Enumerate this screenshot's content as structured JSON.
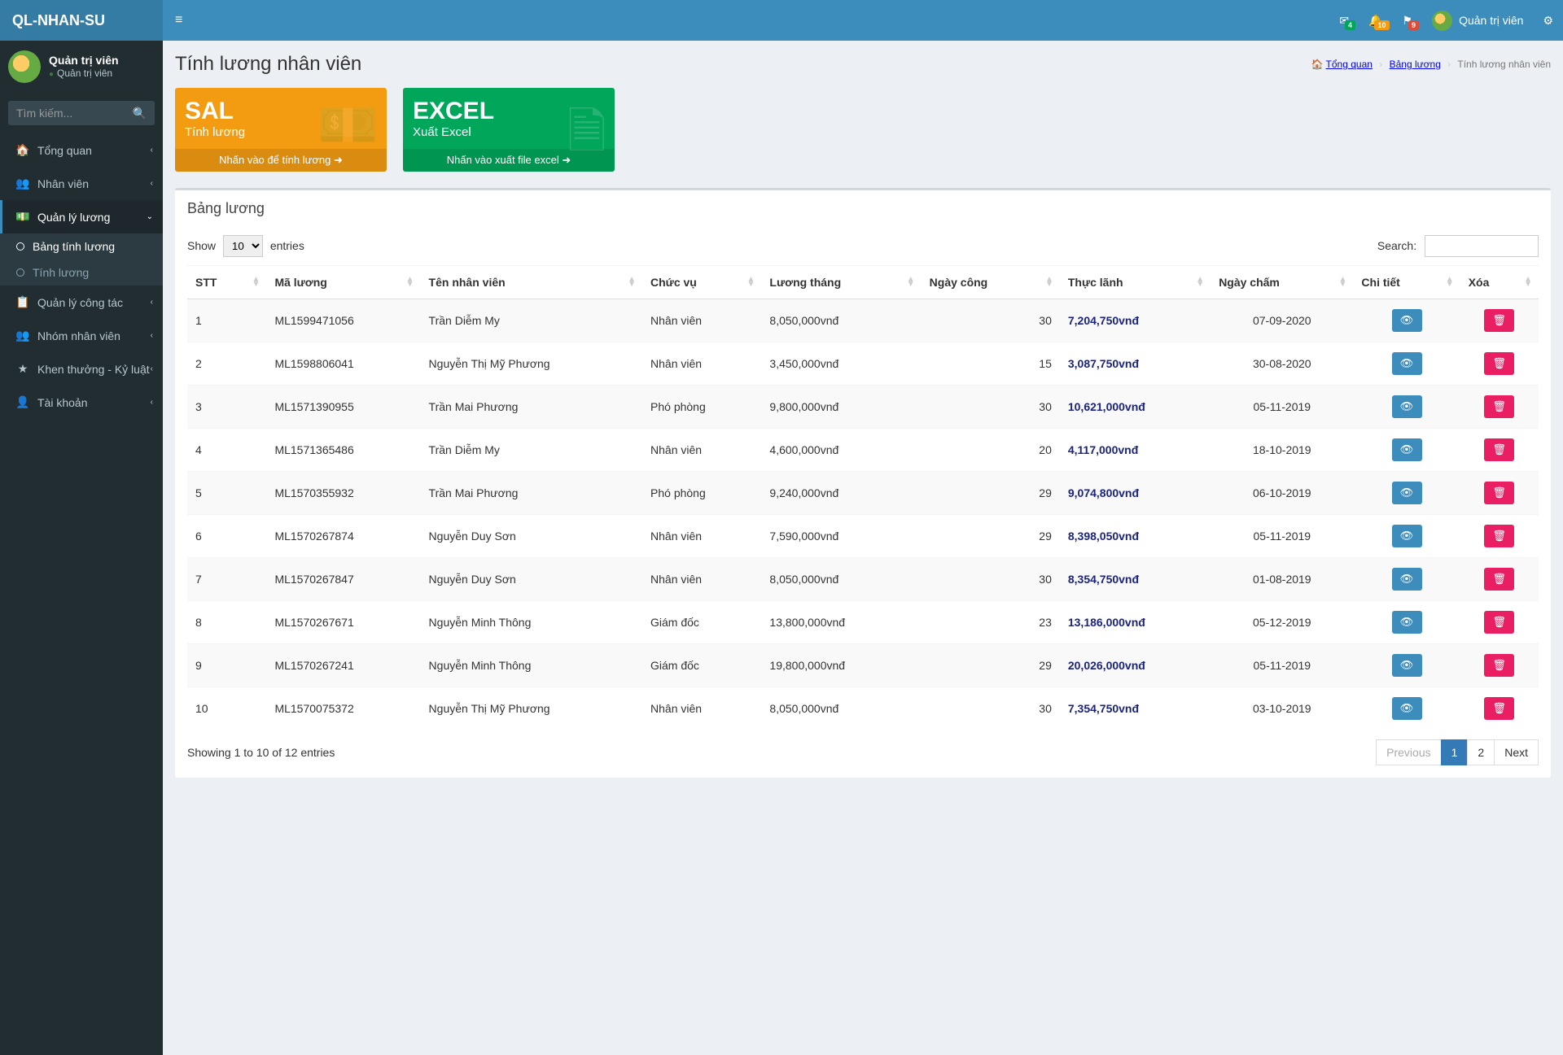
{
  "brand": "QL-NHAN-SU",
  "user": {
    "name": "Quản trị viên",
    "role": "Quản trị viên"
  },
  "search": {
    "placeholder": "Tìm kiếm..."
  },
  "nav": {
    "items": [
      {
        "label": "Tổng quan"
      },
      {
        "label": "Nhân viên"
      },
      {
        "label": "Quản lý lương",
        "sub": [
          {
            "label": "Bảng tính lương",
            "active": true
          },
          {
            "label": "Tính lương"
          }
        ]
      },
      {
        "label": "Quản lý công tác"
      },
      {
        "label": "Nhóm nhân viên"
      },
      {
        "label": "Khen thưởng - Kỷ luật"
      },
      {
        "label": "Tài khoản"
      }
    ]
  },
  "topbar": {
    "badges": {
      "mail": "4",
      "bell": "10",
      "flag": "9"
    },
    "username": "Quản trị viên"
  },
  "page": {
    "title": "Tính lương nhân viên",
    "breadcrumb": {
      "home": "Tổng quan",
      "mid": "Bảng lương",
      "last": "Tính lương nhân viên"
    }
  },
  "cards": {
    "sal": {
      "title": "SAL",
      "subtitle": "Tính lương",
      "footer": "Nhấn vào để tính lương"
    },
    "excel": {
      "title": "EXCEL",
      "subtitle": "Xuất Excel",
      "footer": "Nhấn vào xuất file excel"
    }
  },
  "box": {
    "title": "Bảng lương"
  },
  "datatable": {
    "show_label": "Show",
    "entries_label": "entries",
    "length_value": "10",
    "search_label": "Search:",
    "columns": [
      "STT",
      "Mã lương",
      "Tên nhân viên",
      "Chức vụ",
      "Lương tháng",
      "Ngày công",
      "Thực lãnh",
      "Ngày chấm",
      "Chi tiết",
      "Xóa"
    ],
    "rows": [
      {
        "stt": "1",
        "ma": "ML1599471056",
        "ten": "Trần Diễm My",
        "cv": "Nhân viên",
        "luong": "8,050,000vnđ",
        "cong": "30",
        "thuc": "7,204,750vnđ",
        "ngay": "07-09-2020"
      },
      {
        "stt": "2",
        "ma": "ML1598806041",
        "ten": "Nguyễn Thị Mỹ Phương",
        "cv": "Nhân viên",
        "luong": "3,450,000vnđ",
        "cong": "15",
        "thuc": "3,087,750vnđ",
        "ngay": "30-08-2020"
      },
      {
        "stt": "3",
        "ma": "ML1571390955",
        "ten": "Trần Mai Phương",
        "cv": "Phó phòng",
        "luong": "9,800,000vnđ",
        "cong": "30",
        "thuc": "10,621,000vnđ",
        "ngay": "05-11-2019"
      },
      {
        "stt": "4",
        "ma": "ML1571365486",
        "ten": "Trần Diễm My",
        "cv": "Nhân viên",
        "luong": "4,600,000vnđ",
        "cong": "20",
        "thuc": "4,117,000vnđ",
        "ngay": "18-10-2019"
      },
      {
        "stt": "5",
        "ma": "ML1570355932",
        "ten": "Trần Mai Phương",
        "cv": "Phó phòng",
        "luong": "9,240,000vnđ",
        "cong": "29",
        "thuc": "9,074,800vnđ",
        "ngay": "06-10-2019"
      },
      {
        "stt": "6",
        "ma": "ML1570267874",
        "ten": "Nguyễn Duy Sơn",
        "cv": "Nhân viên",
        "luong": "7,590,000vnđ",
        "cong": "29",
        "thuc": "8,398,050vnđ",
        "ngay": "05-11-2019"
      },
      {
        "stt": "7",
        "ma": "ML1570267847",
        "ten": "Nguyễn Duy Sơn",
        "cv": "Nhân viên",
        "luong": "8,050,000vnđ",
        "cong": "30",
        "thuc": "8,354,750vnđ",
        "ngay": "01-08-2019"
      },
      {
        "stt": "8",
        "ma": "ML1570267671",
        "ten": "Nguyễn Minh Thông",
        "cv": "Giám đốc",
        "luong": "13,800,000vnđ",
        "cong": "23",
        "thuc": "13,186,000vnđ",
        "ngay": "05-12-2019"
      },
      {
        "stt": "9",
        "ma": "ML1570267241",
        "ten": "Nguyễn Minh Thông",
        "cv": "Giám đốc",
        "luong": "19,800,000vnđ",
        "cong": "29",
        "thuc": "20,026,000vnđ",
        "ngay": "05-11-2019"
      },
      {
        "stt": "10",
        "ma": "ML1570075372",
        "ten": "Nguyễn Thị Mỹ Phương",
        "cv": "Nhân viên",
        "luong": "8,050,000vnđ",
        "cong": "30",
        "thuc": "7,354,750vnđ",
        "ngay": "03-10-2019"
      }
    ],
    "info": "Showing 1 to 10 of 12 entries",
    "pagination": {
      "prev": "Previous",
      "pages": [
        "1",
        "2"
      ],
      "next": "Next",
      "active": "1"
    }
  }
}
